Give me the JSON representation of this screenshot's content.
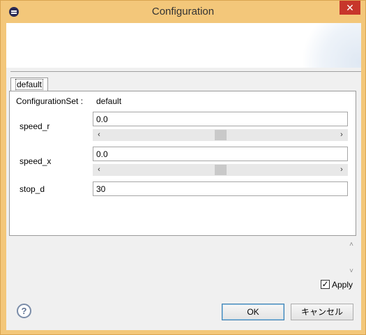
{
  "window": {
    "title": "Configuration",
    "close_glyph": "✕",
    "icon": "menu-icon"
  },
  "tab": {
    "label": "default"
  },
  "config_set": {
    "label": "ConfigurationSet :",
    "value": "default"
  },
  "fields": [
    {
      "label": "speed_r",
      "value": "0.0",
      "slider": 0.5
    },
    {
      "label": "speed_x",
      "value": "0.0",
      "slider": 0.5
    },
    {
      "label": "stop_d",
      "value": "30"
    }
  ],
  "slider_glyphs": {
    "left": "‹",
    "right": "›"
  },
  "scroll_glyphs": {
    "up": "˄",
    "down": "˅"
  },
  "apply": {
    "label": "Apply",
    "checked": true,
    "check_glyph": "✓"
  },
  "help": {
    "glyph": "?"
  },
  "buttons": {
    "ok": "OK",
    "cancel": "キャンセル"
  }
}
